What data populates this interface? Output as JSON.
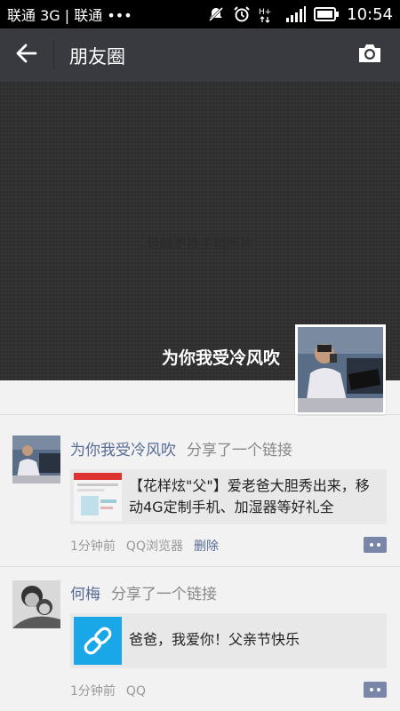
{
  "status_bar": {
    "carrier_text": "联通 3G | 联通 •••",
    "time": "10:54"
  },
  "header": {
    "title": "朋友圈",
    "back_icon": "arrow-left-icon",
    "camera_icon": "camera-icon"
  },
  "cover": {
    "hint": "轻触更换主题照片",
    "owner_name": "为你我受冷风吹"
  },
  "posts": [
    {
      "author": "为你我受冷风吹",
      "action": "分享了一个链接",
      "link_title": "【花样炫\"父\"】爱老爸大胆秀出来，移动4G定制手机、加湿器等好礼全",
      "time": "1分钟前",
      "source": "QQ浏览器",
      "delete_label": "删除"
    },
    {
      "author": "何梅",
      "action": "分享了一个链接",
      "link_title": "爸爸，我爱你！父亲节快乐",
      "time": "1分钟前",
      "source": "QQ"
    }
  ],
  "colors": {
    "header_bg": "#393a3f",
    "link_name": "#576b95",
    "link_icon_bg": "#1aa7e8"
  }
}
